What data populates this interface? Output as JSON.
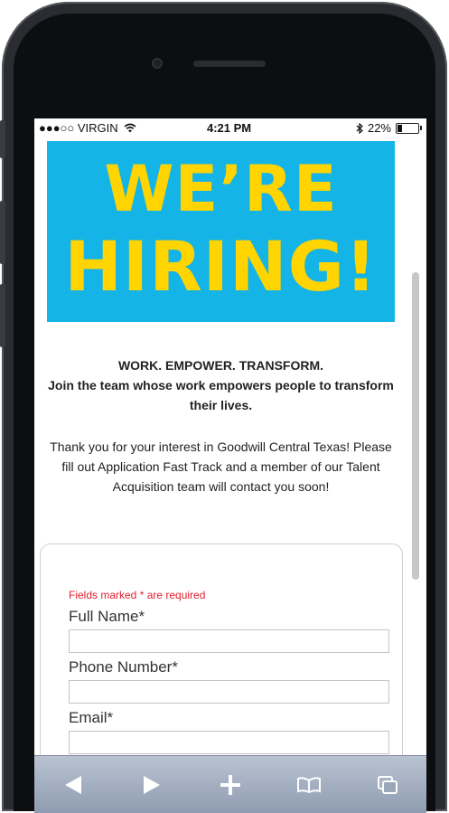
{
  "status_bar": {
    "carrier": "●●●○○ VIRGIN",
    "time": "4:21 PM",
    "battery": "22%",
    "battery_level": 0.22
  },
  "banner": {
    "line1": "WE’RE",
    "line2": "HIRING!"
  },
  "tagline": {
    "line1": "WORK. EMPOWER. TRANSFORM.",
    "line2": "Join the team whose work empowers people to transform their lives."
  },
  "intro_text": "Thank you for your interest in Goodwill Central Texas! Please fill out Application Fast Track and a member of our Talent Acquisition team will contact you soon!",
  "form": {
    "required_note": "Fields marked * are required",
    "full_name_label": "Full Name*",
    "full_name_value": "",
    "phone_label": "Phone Number*",
    "phone_value": "",
    "email_label": "Email*",
    "email_value": ""
  },
  "toolbar": {
    "icons": [
      "back-arrow-icon",
      "forward-arrow-icon",
      "plus-icon",
      "bookmarks-book-icon",
      "tabs-icon"
    ]
  },
  "colors": {
    "banner_bg": "#14b4e6",
    "banner_text": "#ffd400",
    "required_red": "#e0202f"
  }
}
